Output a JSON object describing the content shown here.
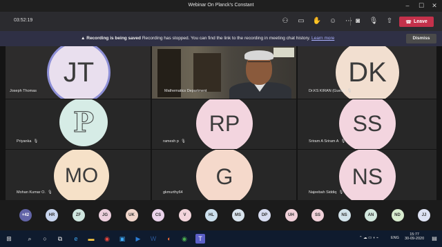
{
  "window": {
    "title": "Webinar On Planck's Constant"
  },
  "meeting": {
    "elapsed": "03:52:19",
    "leave_label": "Leave"
  },
  "banner": {
    "title": "Recording is being saved",
    "message": "Recording has stopped. You can find the link to the recording in meeting chat history.",
    "link": "Learn more",
    "dismiss_label": "Dismiss"
  },
  "tiles": [
    {
      "initials": "JT",
      "name": "Joseph Thomas",
      "avatar_bg": "#e9dfee",
      "avatar_fg": "#3b3b3b",
      "mic": false,
      "highlight": true
    },
    {
      "initials": "",
      "name": "Mathematics Department",
      "video": true,
      "mic": false
    },
    {
      "initials": "DK",
      "name": "Dr.KS KIRAN (Guest)",
      "avatar_bg": "#f2dfd0",
      "avatar_fg": "#3b3b3b",
      "mic": true
    },
    {
      "initials": "P",
      "name": "Priyanka",
      "avatar_bg": "#d6ece6",
      "avatar_fg": "#3b3b3b",
      "mic": true,
      "outline_letter": true
    },
    {
      "initials": "RP",
      "name": "ramesh p",
      "avatar_bg": "#f3d5df",
      "avatar_fg": "#3b3b3b",
      "mic": true
    },
    {
      "initials": "SS",
      "name": "Sriram A Sriram A",
      "avatar_bg": "#f3d5df",
      "avatar_fg": "#3b3b3b",
      "mic": true
    },
    {
      "initials": "MO",
      "name": "Mohan Kumar O.",
      "avatar_bg": "#f6e1c8",
      "avatar_fg": "#3b3b3b",
      "mic": true
    },
    {
      "initials": "G",
      "name": "gkmurthy64",
      "avatar_bg": "#f5d9cb",
      "avatar_fg": "#3b3b3b",
      "mic": false
    },
    {
      "initials": "NS",
      "name": "Najeebah Siddiq",
      "avatar_bg": "#f3d5df",
      "avatar_fg": "#3b3b3b",
      "mic": true
    }
  ],
  "roster": {
    "overflow": "+42",
    "chips": [
      {
        "initials": "HR",
        "bg": "#c9d6ef"
      },
      {
        "initials": "ZF",
        "bg": "#cfe6df"
      },
      {
        "initials": "JG",
        "bg": "#eccfdd"
      },
      {
        "initials": "UK",
        "bg": "#f1d6cb"
      },
      {
        "initials": "CS",
        "bg": "#ead3ea"
      },
      {
        "initials": "V",
        "bg": "#f2d5db"
      },
      {
        "initials": "HL",
        "bg": "#cde1ee"
      },
      {
        "initials": "MS",
        "bg": "#d9e4ee"
      },
      {
        "initials": "DP",
        "bg": "#d7dcf0"
      },
      {
        "initials": "UH",
        "bg": "#f1d1d9"
      },
      {
        "initials": "SS",
        "bg": "#f1d1d9"
      },
      {
        "initials": "NS",
        "bg": "#d2e2ea"
      },
      {
        "initials": "AN",
        "bg": "#d3e8de"
      },
      {
        "initials": "ND",
        "bg": "#d8eccf"
      },
      {
        "initials": "JJ",
        "bg": "#dde2f3"
      }
    ]
  },
  "taskbar": {
    "lang": "ENG",
    "time": "15:77",
    "date": "30-09-2020"
  },
  "colors": {
    "accent": "#6264a7",
    "leave": "#c4314b",
    "banner": "#2f3045",
    "taskbar": "#0f1b2e"
  }
}
